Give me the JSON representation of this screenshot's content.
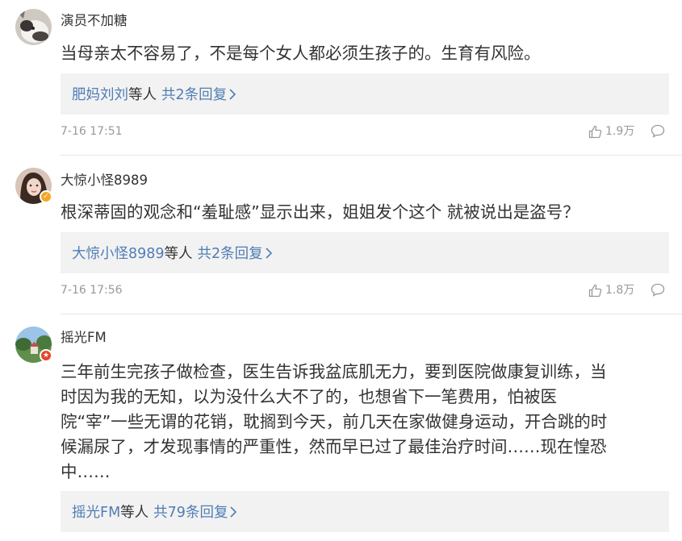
{
  "comments": [
    {
      "username": "演员不加糖",
      "avatar_icon": "cat-avatar-icon",
      "content": "当母亲太不容易了，不是每个女人都必须生孩子的。生育有风险。",
      "reply_names": "肥妈刘刘",
      "reply_etc": "等人",
      "reply_count": "共2条回复",
      "time": "7-16 17:51",
      "likes": "1.9万"
    },
    {
      "username": "大惊小怪8989",
      "avatar_icon": "woman-avatar-icon",
      "badge": "verified-badge-icon",
      "content": "根深蒂固的观念和“羞耻感”显示出来，姐姐发个这个 就被说出是盗号？",
      "reply_names": "大惊小怪8989",
      "reply_etc": "等人",
      "reply_count": "共2条回复",
      "time": "7-16 17:56",
      "likes": "1.8万"
    },
    {
      "username": "摇光FM",
      "avatar_icon": "landscape-avatar-icon",
      "badge": "official-badge-icon",
      "content_lines": [
        "三年前生完孩子做检查，医生告诉我盆底肌无力，要到医院做康复训练，当",
        "时因为我的无知，以为没什么大不了的，也想省下一笔费用，怕被医",
        "院“宰”一些无谓的花销，耽搁到今天，前几天在家做健身运动，开合跳的时",
        "候漏尿了，才发现事情的严重性，然而早已过了最佳治疗时间……现在惶恐",
        "中……"
      ],
      "reply_names": "摇光FM",
      "reply_etc": "等人",
      "reply_count": "共79条回复"
    }
  ],
  "colors": {
    "link": "#4f7db5",
    "meta": "#999999",
    "reply_bg": "#f2f2f2",
    "verified": "#f5a623",
    "official": "#e8432d"
  }
}
